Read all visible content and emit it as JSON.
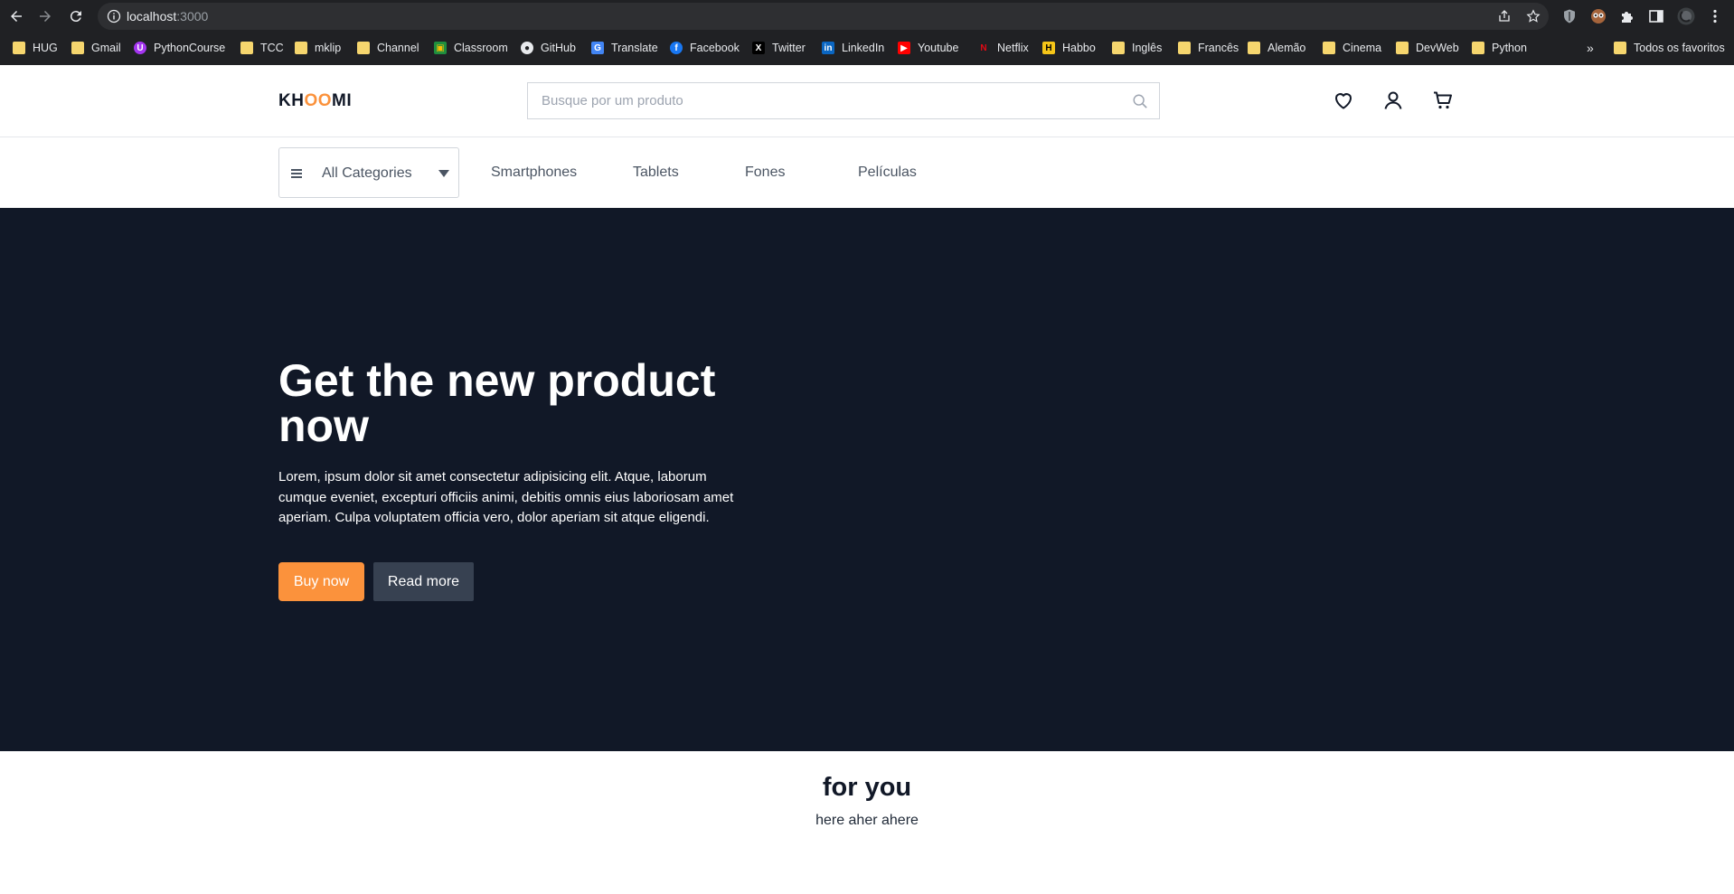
{
  "browser": {
    "url_host": "localhost",
    "url_port": ":3000",
    "bookmarks": [
      {
        "label": "HUG",
        "icon": "folder-icon"
      },
      {
        "label": "Gmail",
        "icon": "folder-icon"
      },
      {
        "label": "PythonCourse",
        "icon": "udemy-icon"
      },
      {
        "label": "TCC",
        "icon": "folder-icon"
      },
      {
        "label": "mklip",
        "icon": "folder-icon"
      },
      {
        "label": "Channel",
        "icon": "folder-icon"
      },
      {
        "label": "Classroom",
        "icon": "classroom-icon"
      },
      {
        "label": "GitHub",
        "icon": "github-icon"
      },
      {
        "label": "Translate",
        "icon": "translate-icon"
      },
      {
        "label": "Facebook",
        "icon": "facebook-icon"
      },
      {
        "label": "Twitter",
        "icon": "x-icon"
      },
      {
        "label": "LinkedIn",
        "icon": "linkedin-icon"
      },
      {
        "label": "Youtube",
        "icon": "youtube-icon"
      },
      {
        "label": "Netflix",
        "icon": "netflix-icon"
      },
      {
        "label": "Habbo",
        "icon": "habbo-icon"
      },
      {
        "label": "Inglês",
        "icon": "folder-icon"
      },
      {
        "label": "Francês",
        "icon": "folder-icon"
      },
      {
        "label": "Alemão",
        "icon": "folder-icon"
      },
      {
        "label": "Cinema",
        "icon": "folder-icon"
      },
      {
        "label": "DevWeb",
        "icon": "folder-icon"
      },
      {
        "label": "Python",
        "icon": "folder-icon"
      }
    ],
    "overflow_label": "»",
    "all_bookmarks_label": "Todos os favoritos"
  },
  "header": {
    "logo_prefix": "KH",
    "logo_accent": "OO",
    "logo_suffix": "MI",
    "search_placeholder": "Busque por um produto"
  },
  "categories": {
    "all_label": "All Categories",
    "links": [
      "Smartphones",
      "Tablets",
      "Fones",
      "Películas"
    ]
  },
  "hero": {
    "title": "Get the new product now",
    "text": "Lorem, ipsum dolor sit amet consectetur adipisicing elit. Atque, laborum cumque eveniet, excepturi officiis animi, debitis omnis eius laboriosam amet aperiam. Culpa voluptatem officia vero, dolor aperiam sit atque eligendi.",
    "buy_label": "Buy now",
    "read_label": "Read more"
  },
  "for_you": {
    "title": "for you",
    "subtitle": "here aher ahere"
  },
  "colors": {
    "accent": "#fb923c",
    "hero_bg": "#111827",
    "chrome_bg": "#202124"
  }
}
